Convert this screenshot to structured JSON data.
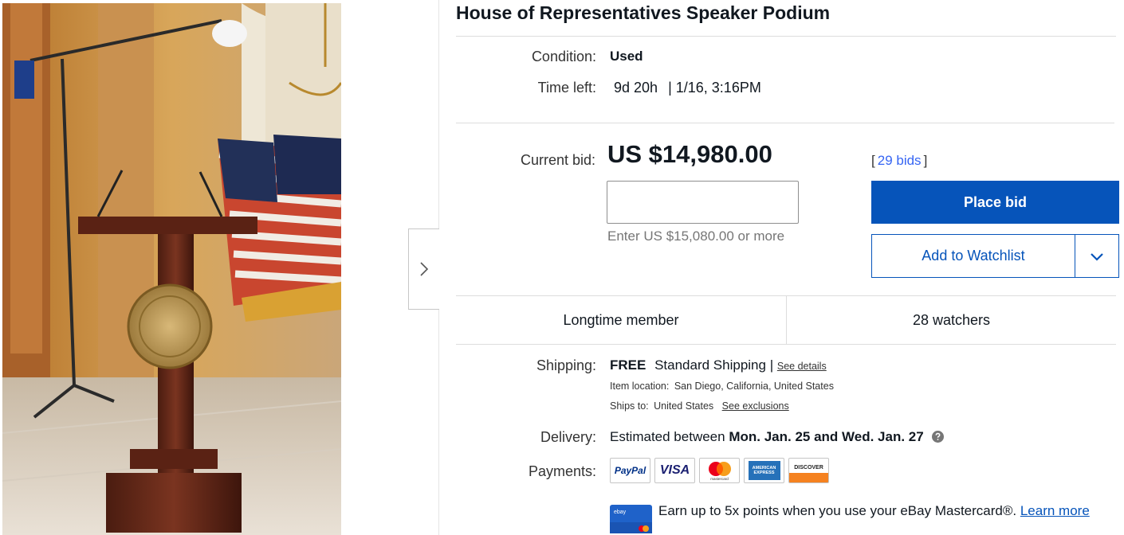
{
  "item": {
    "title": "House of Representatives Speaker Podium"
  },
  "gallery": {
    "image_alt": "podium-photo",
    "next_icon": "chevron-right-icon"
  },
  "details": {
    "condition_label": "Condition:",
    "condition_value": "Used",
    "time_label": "Time left:",
    "time_value": "9d 20h",
    "time_end": "| 1/16, 3:16PM"
  },
  "bidding": {
    "current_bid_label": "Current bid:",
    "current_bid": "US $14,980.00",
    "bid_input_placeholder": "",
    "bid_hint": "Enter US $15,080.00 or more",
    "bids_open": "[",
    "bids_count": "29 bids",
    "bids_close": "]",
    "place_bid": "Place bid",
    "add_watchlist": "Add to Watchlist",
    "dropdown_icon": "chevron-down-icon"
  },
  "stats": {
    "seller_note": "Longtime member",
    "watchers": "28 watchers"
  },
  "shipping": {
    "label": "Shipping:",
    "cost": "FREE",
    "method": "Standard Shipping",
    "separator": "|",
    "details_link": "See details",
    "location_label": "Item location:",
    "location": "San Diego, California, United States",
    "ships_to_label": "Ships to:",
    "ships_to": "United States",
    "exclusions_link": "See exclusions"
  },
  "delivery": {
    "label": "Delivery:",
    "prefix": "Estimated between",
    "range": "Mon. Jan. 25 and Wed. Jan. 27"
  },
  "payments": {
    "label": "Payments:",
    "methods": [
      "PayPal",
      "VISA",
      "mastercard",
      "AMERICAN EXPRESS",
      "DISCOVER"
    ]
  },
  "promo": {
    "text": "Earn up to 5x points when you use your eBay Mastercard®.",
    "link": "Learn more",
    "card_label": "ebay"
  },
  "colors": {
    "primary": "#0654ba",
    "link": "#3665f3",
    "divider": "#dddddd"
  }
}
